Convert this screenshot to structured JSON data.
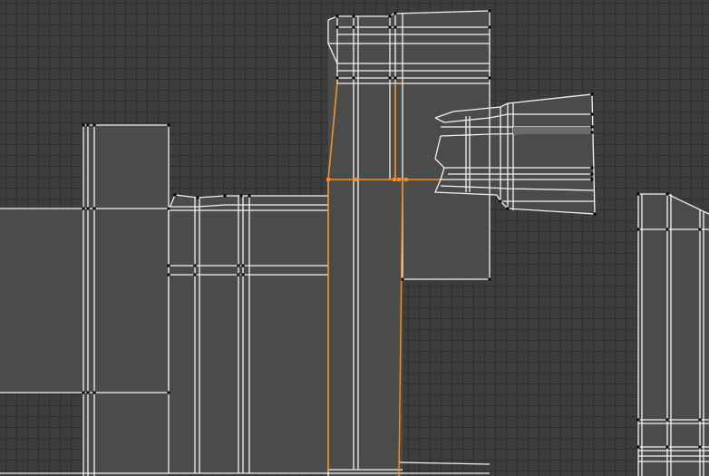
{
  "editor": {
    "type": "uv-editor",
    "selection_color": "#ff8c1a",
    "edge_color": "#f2f2f2",
    "background_color": "#3d3d3d",
    "grid_color": "#2f2f2f"
  }
}
